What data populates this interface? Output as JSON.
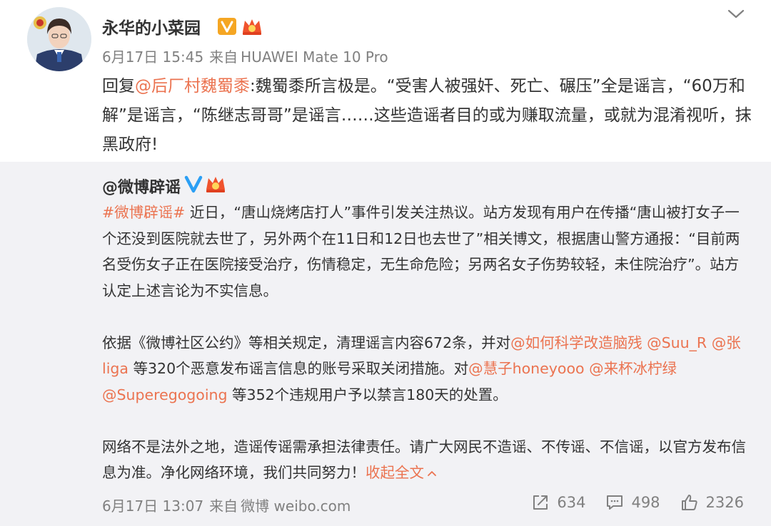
{
  "author": {
    "name": "永华的小菜园",
    "timestamp": "6月17日 15:45",
    "source_prefix": "来自",
    "device": "HUAWEI Mate 10 Pro",
    "avatar": "police-officer-avatar"
  },
  "reply": {
    "prefix": "回复",
    "mention": "@后厂村魏蜀黍",
    "body": ":魏蜀黍所言极是。“受害人被强奸、死亡、碾压”全是谣言，“60万和解”是谣言，“陈继志哥哥”是谣言……这些造谣者目的或为赚取流量，或就为混淆视听，抹黑政府!"
  },
  "repost": {
    "source_name": "@微博辟谣",
    "p1_tag": "#微博辟谣#",
    "p1_body": " 近日，“唐山烧烤店打人”事件引发关注热议。站方发现有用户在传播“唐山被打女子一个还没到医院就去世了，另外两个在11日和12日也去世了”相关博文，根据唐山警方通报：“目前两名受伤女子正在医院接受治疗，伤情稳定，无生命危险；另两名女子伤势较轻，未住院治疗”。站方认定上述言论为不实信息。",
    "p2_a": "依据《微博社区公约》等相关规定，清理谣言内容672条，并对",
    "p2_m1": "@如何科学改造脑残",
    "p2_m2": "@Suu_R",
    "p2_m3": "@张liga",
    "p2_b": " 等320个恶意发布谣言信息的账号采取关闭措施。对",
    "p2_m4": "@慧子honeyooo",
    "p2_m5": "@来杯冰柠绿",
    "p2_m6": "@Superegogoing",
    "p2_c": " 等352个违规用户予以禁言180天的处置。",
    "p3_body": "网络不是法外之地，造谣传谣需承担法律责任。请广大网民不造谣、不传谣、不信谣，以官方发布信息为准。净化网络环境，我们共同努力！",
    "collapse_label": "收起全文",
    "timestamp": "6月17日 13:07",
    "source_prefix": "来自",
    "source_app": "微博 weibo.com",
    "reposts": "634",
    "comments": "498",
    "likes": "2326"
  },
  "colors": {
    "link": "#eb7350",
    "verified_blue": "#2b9ff4",
    "repost_bg": "#f2f2f5",
    "meta_gray": "#808080"
  }
}
